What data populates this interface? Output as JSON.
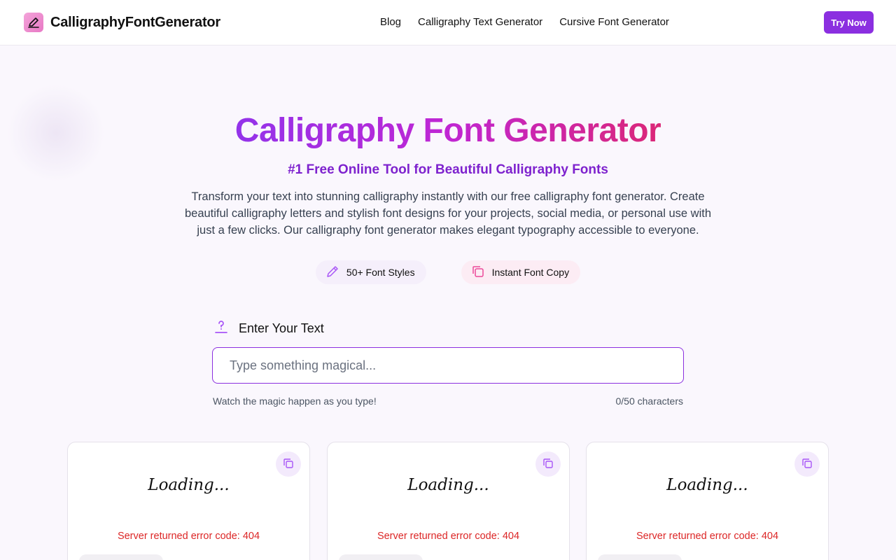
{
  "header": {
    "logo_text": "CalligraphyFontGenerator",
    "nav": [
      "Blog",
      "Calligraphy Text Generator",
      "Cursive Font Generator"
    ],
    "cta_label": "Try Now"
  },
  "hero": {
    "title": "Calligraphy Font Generator",
    "subtitle": "#1 Free Online Tool for Beautiful Calligraphy Fonts",
    "description": "Transform your text into stunning calligraphy instantly with our free calligraphy font generator. Create beautiful calligraphy letters and stylish font designs for your projects, social media, or personal use with just a few clicks. Our calligraphy font generator makes elegant typography accessible to everyone.",
    "features": [
      {
        "label": "50+ Font Styles",
        "icon": "pencil-icon"
      },
      {
        "label": "Instant Font Copy",
        "icon": "copy-icon"
      }
    ]
  },
  "input": {
    "label": "Enter Your Text",
    "placeholder": "Type something magical...",
    "value": "",
    "hint": "Watch the magic happen as you type!",
    "counter": "0/50 characters"
  },
  "cards": [
    {
      "preview": "Loading...",
      "error": "Server returned error code: 404"
    },
    {
      "preview": "Loading...",
      "error": "Server returned error code: 404"
    },
    {
      "preview": "Loading...",
      "error": "Server returned error code: 404"
    }
  ],
  "colors": {
    "accent": "#8b2fe0",
    "gradient_start": "#9333ea",
    "gradient_end": "#db2777",
    "error": "#dc2626",
    "subtitle": "#7e22ce"
  }
}
